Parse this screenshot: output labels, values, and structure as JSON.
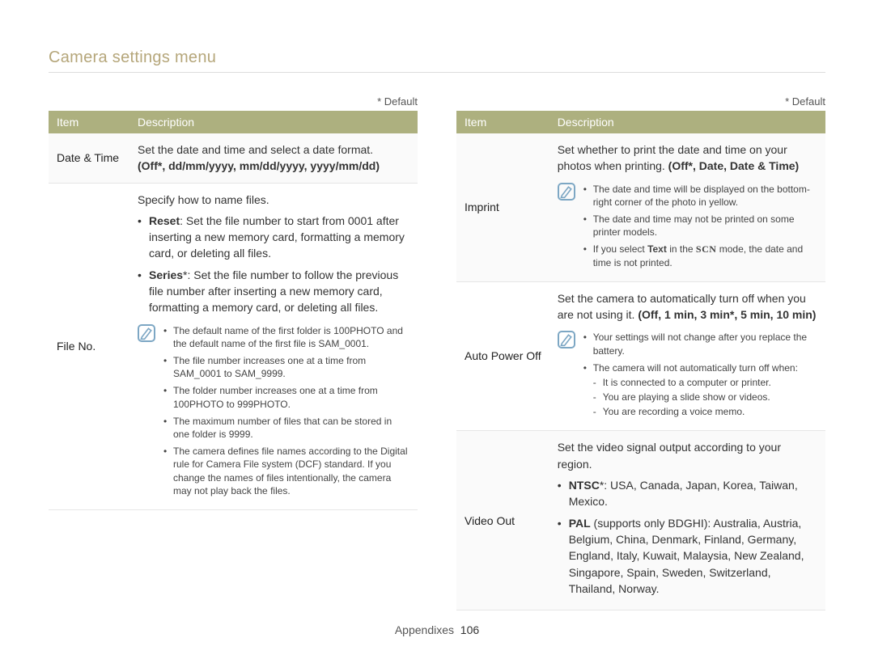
{
  "page_title": "Camera settings menu",
  "default_note": "* Default",
  "header": {
    "item": "Item",
    "description": "Description"
  },
  "left": {
    "date_time": {
      "item": "Date & Time",
      "desc": "Set the date and time and select a date format.",
      "options": "(Off*, dd/mm/yyyy, mm/dd/yyyy, yyyy/mm/dd)"
    },
    "file_no": {
      "item": "File No.",
      "intro": "Specify how to name files.",
      "b1_label": "Reset",
      "b1_text": ": Set the file number to start from 0001 after inserting a new memory card, formatting a memory card, or deleting all files.",
      "b2_label": "Series",
      "b2_text": "*: Set the file number to follow the previous file number after inserting a new memory card, formatting a memory card, or deleting all files.",
      "n1": "The default name of the first folder is 100PHOTO and the default name of the first file is SAM_0001.",
      "n2": "The file number increases one at a time from SAM_0001 to SAM_9999.",
      "n3": "The folder number increases one at a time from 100PHOTO to 999PHOTO.",
      "n4": "The maximum number of files that can be stored in one folder is 9999.",
      "n5": "The camera defines file names according to the Digital rule for Camera File system (DCF) standard. If you change the names of files intentionally, the camera may not play back the files."
    }
  },
  "right": {
    "imprint": {
      "item": "Imprint",
      "desc": "Set whether to print the date and time on your photos when printing. ",
      "options": "(Off*, Date, Date & Time)",
      "n1": "The date and time will be displayed on the bottom-right corner of the photo in yellow.",
      "n2": "The date and time may not be printed on some printer models.",
      "n3a": "If you select ",
      "n3_text_bold": "Text",
      "n3b": " in the ",
      "n3_scn": "SCN",
      "n3c": " mode, the date and time is not printed."
    },
    "auto_power": {
      "item": "Auto Power Off",
      "desc": "Set the camera to automatically turn off when you are not using it. ",
      "options": "(Off, 1 min, 3 min*, 5 min, 10 min)",
      "n1": "Your settings will not change after you replace the battery.",
      "n2": "The camera will not automatically turn off when:",
      "d1": "It is connected to a computer or printer.",
      "d2": "You are playing a slide show or videos.",
      "d3": "You are recording a voice memo."
    },
    "video_out": {
      "item": "Video Out",
      "desc": "Set the video signal output according to your region.",
      "b1_label": "NTSC",
      "b1_text": "*: USA, Canada, Japan, Korea, Taiwan, Mexico.",
      "b2_label": "PAL",
      "b2_text": " (supports only BDGHI): Australia, Austria, Belgium, China, Denmark, Finland, Germany, England, Italy, Kuwait, Malaysia, New Zealand, Singapore, Spain, Sweden, Switzerland, Thailand, Norway."
    }
  },
  "footer": {
    "section": "Appendixes",
    "page": "106"
  }
}
